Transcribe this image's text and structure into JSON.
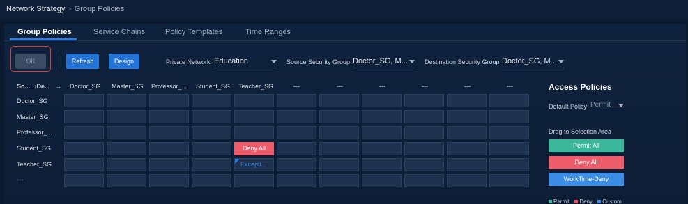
{
  "breadcrumb": {
    "root": "Network Strategy",
    "separator": ">",
    "current": "Group Policies"
  },
  "tabs": [
    {
      "label": "Group Policies",
      "active": true
    },
    {
      "label": "Service Chains"
    },
    {
      "label": "Policy Templates"
    },
    {
      "label": "Time Ranges"
    }
  ],
  "toolbar": {
    "ok_label": "OK",
    "refresh_label": "Refresh",
    "design_label": "Design",
    "private_network_label": "Private Network",
    "private_network_value": "Education",
    "source_group_label": "Source Security Group",
    "source_group_value": "Doctor_SG, M...",
    "dest_group_label": "Destination Security Group",
    "dest_group_value": "Doctor_SG, M..."
  },
  "matrix": {
    "corner_src": "So...",
    "corner_dst": "↓De...",
    "corner_arrow": "→",
    "columns": [
      "Doctor_SG",
      "Master_SG",
      "Professor_...",
      "Student_SG",
      "Teacher_SG",
      "---",
      "---",
      "---",
      "---",
      "---",
      "---"
    ],
    "rows": [
      "Doctor_SG",
      "Master_SG",
      "Professor_...",
      "Student_SG",
      "Teacher_SG",
      "---"
    ],
    "special_cells": {
      "deny_all": "Deny All",
      "exception": "Excepti..."
    }
  },
  "access_policies": {
    "title": "Access Policies",
    "default_policy_label": "Default Policy",
    "default_policy_value": "Permit",
    "drag_label": "Drag to Selection Area",
    "buttons": [
      {
        "label": "Permit All",
        "color": "#3bb89c"
      },
      {
        "label": "Deny All",
        "color": "#ee5d6c"
      },
      {
        "label": "WorkTime-Deny",
        "color": "#3c8de6"
      }
    ],
    "legend": [
      {
        "label": "Permit",
        "color": "#3bb89c"
      },
      {
        "label": "Deny",
        "color": "#ee4b5c"
      },
      {
        "label": "Custom",
        "color": "#3c8de6"
      }
    ]
  },
  "colors": {
    "background": "#0c1a30",
    "accent": "#2474d8",
    "highlight_outline": "#e33a3a"
  }
}
